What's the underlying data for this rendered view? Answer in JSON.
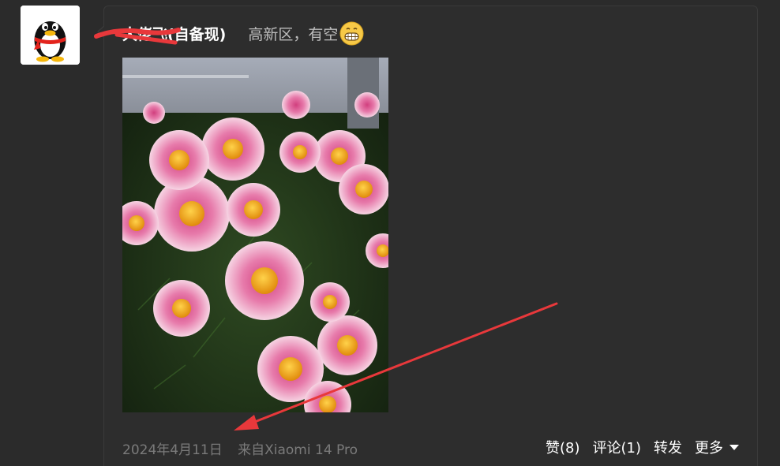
{
  "author": {
    "name": "大佬飞(自备现)",
    "avatar_icon": "qq-penguin-icon"
  },
  "post": {
    "text": "高新区，有空",
    "emoji": "grin-emoji-icon",
    "photo_subject": "pink-daisies-photo"
  },
  "footer": {
    "date": "2024年4月11日",
    "source": "来自Xiaomi 14 Pro"
  },
  "actions": {
    "like": "赞(8)",
    "comment": "评论(1)",
    "forward": "转发",
    "more": "更多"
  },
  "colors": {
    "background": "#2b2b2b",
    "card": "#2d2d2d",
    "annotation_red": "#e8383b"
  }
}
